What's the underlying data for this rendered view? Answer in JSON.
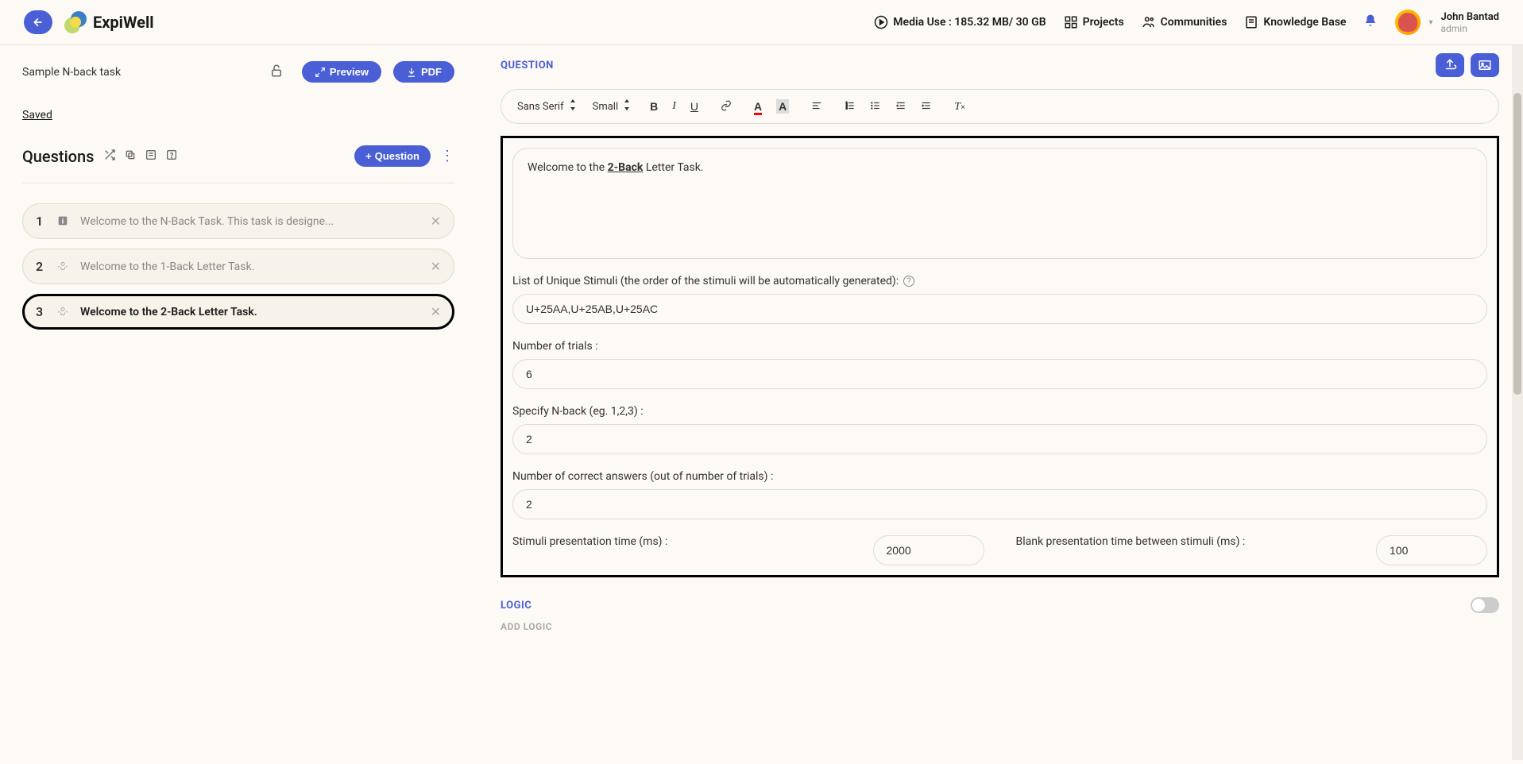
{
  "nav": {
    "brand": "ExpiWell",
    "media_use": "Media Use : 185.32 MB/ 30 GB",
    "projects": "Projects",
    "communities": "Communities",
    "knowledge_base": "Knowledge Base"
  },
  "user": {
    "name": "John Bantad",
    "role": "admin"
  },
  "task": {
    "title": "Sample N-back task",
    "preview_label": "Preview",
    "pdf_label": "PDF",
    "saved_label": "Saved"
  },
  "questions_panel": {
    "title": "Questions",
    "add_button": "Question"
  },
  "questions": [
    {
      "num": "1",
      "text": "Welcome to the N-Back Task. This task is designe..."
    },
    {
      "num": "2",
      "text": "Welcome to the 1-Back Letter Task."
    },
    {
      "num": "3",
      "text": "Welcome to the 2-Back Letter Task."
    }
  ],
  "editor": {
    "section_title": "QUESTION",
    "font_family": "Sans Serif",
    "font_size": "Small",
    "content_prefix": "Welcome to the ",
    "content_bold": "2-Back",
    "content_suffix": " Letter Task."
  },
  "fields": {
    "stimuli_label": "List of Unique Stimuli (the order of the stimuli will be automatically generated):",
    "stimuli_value": "U+25AA,U+25AB,U+25AC",
    "trials_label": "Number of trials :",
    "trials_value": "6",
    "nback_label": "Specify N-back (eg. 1,2,3) :",
    "nback_value": "2",
    "correct_label": "Number of correct answers (out of number of trials) :",
    "correct_value": "2",
    "presentation_label": "Stimuli presentation time (ms) :",
    "presentation_value": "2000",
    "blank_label": "Blank presentation time between stimuli (ms) :",
    "blank_value": "100"
  },
  "logic": {
    "title": "LOGIC",
    "add_label": "ADD LOGIC"
  }
}
